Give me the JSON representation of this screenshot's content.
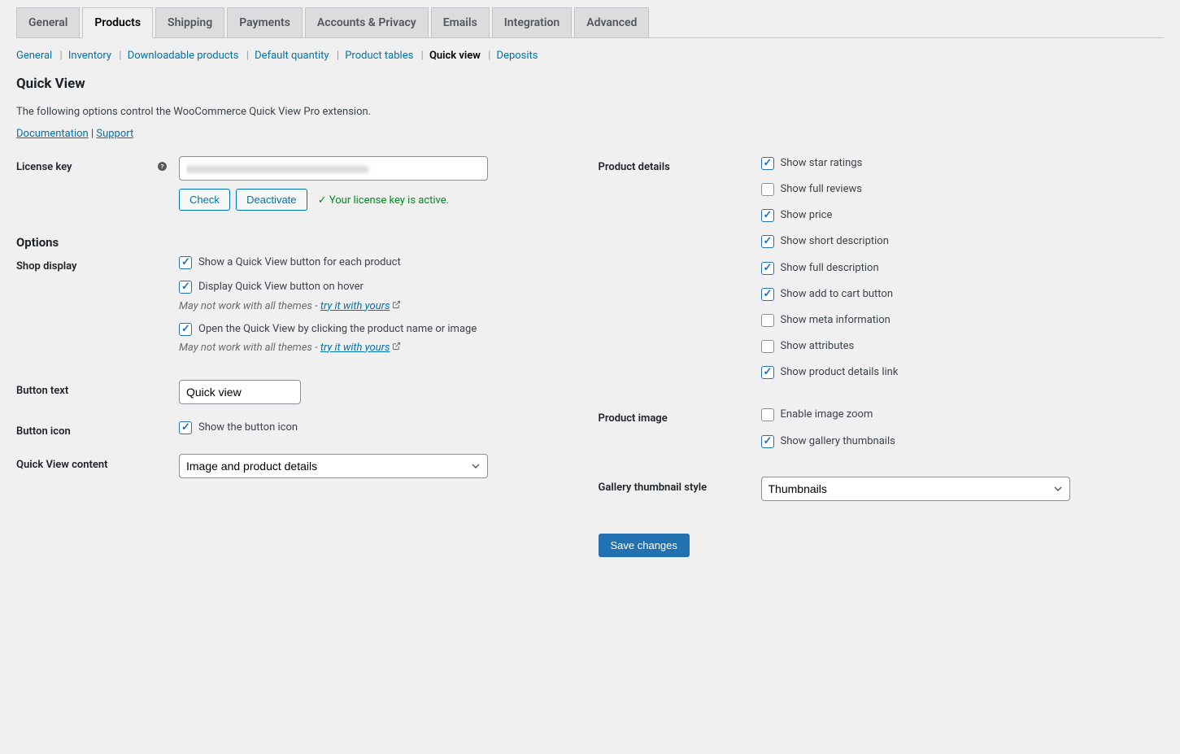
{
  "tabs": [
    "General",
    "Products",
    "Shipping",
    "Payments",
    "Accounts & Privacy",
    "Emails",
    "Integration",
    "Advanced"
  ],
  "active_tab": 1,
  "subtabs": [
    "General",
    "Inventory",
    "Downloadable products",
    "Default quantity",
    "Product tables",
    "Quick view",
    "Deposits"
  ],
  "active_subtab": 5,
  "page_title": "Quick View",
  "intro": "The following options control the WooCommerce Quick View Pro extension.",
  "doc_link": "Documentation",
  "sep": " | ",
  "support_link": "Support",
  "license": {
    "label": "License key",
    "value": "xxxxxxxxxxxxxxxxxxxxxxxxxxxxxxxx",
    "check": "Check",
    "deactivate": "Deactivate",
    "status": "Your license key is active."
  },
  "options_heading": "Options",
  "shop_display": {
    "label": "Shop display",
    "row1": "Show a Quick View button for each product",
    "row2": "Display Quick View button on hover",
    "hint_prefix": "May not work with all themes - ",
    "hint_link": "try it with yours",
    "row3": "Open the Quick View by clicking the product name or image"
  },
  "button_text": {
    "label": "Button text",
    "value": "Quick view"
  },
  "button_icon": {
    "label": "Button icon",
    "text": "Show the button icon"
  },
  "qv_content": {
    "label": "Quick View content",
    "value": "Image and product details"
  },
  "product_details": {
    "label": "Product details",
    "items": [
      {
        "text": "Show star ratings",
        "checked": true
      },
      {
        "text": "Show full reviews",
        "checked": false
      },
      {
        "text": "Show price",
        "checked": true
      },
      {
        "text": "Show short description",
        "checked": true
      },
      {
        "text": "Show full description",
        "checked": true
      },
      {
        "text": "Show add to cart button",
        "checked": true
      },
      {
        "text": "Show meta information",
        "checked": false
      },
      {
        "text": "Show attributes",
        "checked": false
      },
      {
        "text": "Show product details link",
        "checked": true
      }
    ]
  },
  "product_image": {
    "label": "Product image",
    "items": [
      {
        "text": "Enable image zoom",
        "checked": false
      },
      {
        "text": "Show gallery thumbnails",
        "checked": true
      }
    ]
  },
  "gallery_style": {
    "label": "Gallery thumbnail style",
    "value": "Thumbnails"
  },
  "save": "Save changes"
}
